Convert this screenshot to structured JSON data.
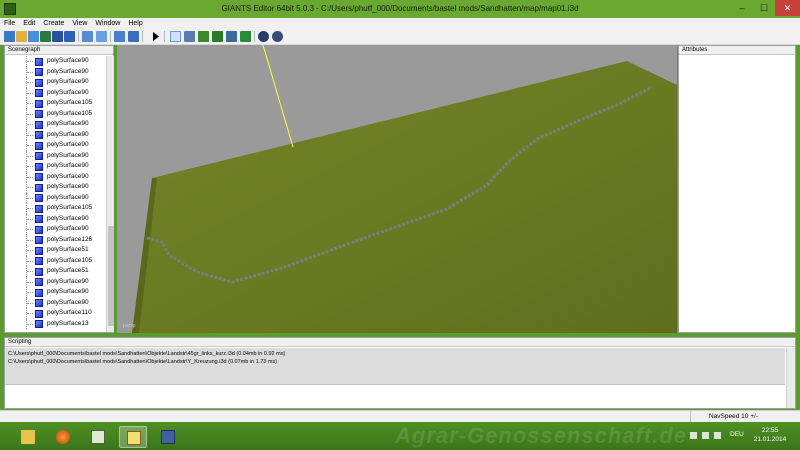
{
  "window": {
    "title": "GIANTS Editor 64bit 5.0.3 - C:/Users/phutf_000/Documents/bastel mods/Sandhatten/map/map01.i3d",
    "minimize": "‒",
    "maximize": "☐",
    "close": "✕"
  },
  "menu": {
    "file": "File",
    "edit": "Edit",
    "create": "Create",
    "view": "View",
    "window": "Window",
    "help": "Help"
  },
  "toolbar_icons": [
    "new-file-icon",
    "open-icon",
    "import-icon",
    "export-icon",
    "save-icon",
    "save-as-icon",
    "select-icon",
    "undo-icon",
    "redo-icon",
    "play-icon",
    "move-icon",
    "rotate-icon",
    "terrain-raise-icon",
    "terrain-paint-icon",
    "terrain-smooth-icon",
    "foliage-icon",
    "grass-icon",
    "gear-icon",
    "settings-icon"
  ],
  "scenegraph": {
    "header": "Scenegraph",
    "items": [
      "polySurface90",
      "polySurface90",
      "polySurface90",
      "polySurface90",
      "polySurface105",
      "polySurface105",
      "polySurface90",
      "polySurface90",
      "polySurface90",
      "polySurface90",
      "polySurface90",
      "polySurface90",
      "polySurface90",
      "polySurface90",
      "polySurface105",
      "polySurface90",
      "polySurface90",
      "polySurface126",
      "polySurface51",
      "polySurface105",
      "polySurface51",
      "polySurface90",
      "polySurface90",
      "polySurface90",
      "polySurface110",
      "polySurface13"
    ]
  },
  "viewport": {
    "camera": "persp",
    "terrain_color": "#6e7a23",
    "sky_color": "#9a9a9a"
  },
  "attributes": {
    "header": "Attributes"
  },
  "scripting": {
    "header": "Scripting",
    "log": [
      "C:\\Users\\phutf_000\\Documents\\bastel mods\\Sandhatten\\Objekte\\Landstr\\45gr_links_kurz.i3d (0.04mb in 0.92 ms)",
      "C:\\Users\\phutf_000\\Documents\\bastel mods\\Sandhatten\\Objekte\\Landstr\\Y_Kreuzung.i3d (0.07mb in 1.73 ms)"
    ]
  },
  "status": {
    "navspeed": "NavSpeed 10 +/-"
  },
  "taskbar": {
    "apps": [
      "file-explorer-icon",
      "firefox-icon",
      "task-manager-icon",
      "giants-editor-icon",
      "remote-desktop-icon"
    ],
    "watermark": "Agrar-Genossenschaft.de",
    "language": "DEU",
    "time": "22:55",
    "date": "21.01.2014"
  }
}
